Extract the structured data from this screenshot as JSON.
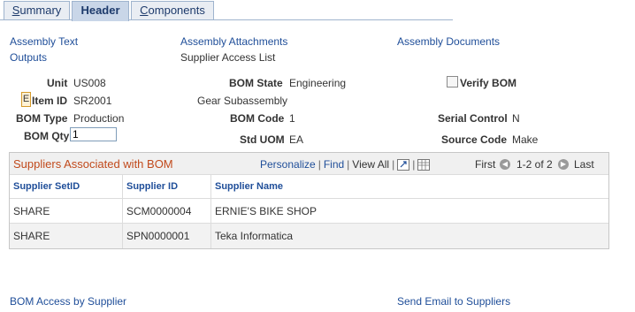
{
  "tabs": [
    {
      "label": "Summary",
      "accel": "S",
      "rest": "ummary"
    },
    {
      "label": "Header",
      "accel": "",
      "rest": "Header"
    },
    {
      "label": "Components",
      "accel": "C",
      "rest": "omponents"
    }
  ],
  "links": {
    "assembly_text": "Assembly Text",
    "assembly_attachments": "Assembly Attachments",
    "assembly_documents": "Assembly Documents",
    "outputs": "Outputs",
    "supplier_access_list": "Supplier Access List",
    "bom_access_by_supplier": "BOM Access by Supplier",
    "send_email": "Send Email to Suppliers"
  },
  "fields": {
    "unit_label": "Unit",
    "unit_value": "US008",
    "item_marker": "E",
    "item_id_label": "Item ID",
    "item_id_value": "SR2001",
    "item_desc": "Gear Subassembly",
    "bom_type_label": "BOM Type",
    "bom_type_value": "Production",
    "bom_qty_label": "BOM Qty",
    "bom_qty_value": "1",
    "bom_state_label": "BOM State",
    "bom_state_value": "Engineering",
    "bom_code_label": "BOM Code",
    "bom_code_value": "1",
    "std_uom_label": "Std UOM",
    "std_uom_value": "EA",
    "verify_bom_label": "Verify BOM",
    "serial_control_label": "Serial Control",
    "serial_control_value": "N",
    "source_code_label": "Source Code",
    "source_code_value": "Make"
  },
  "grid": {
    "title": "Suppliers Associated with BOM",
    "personalize": "Personalize",
    "find": "Find",
    "view_all": "View All",
    "first": "First",
    "range": "1-2 of 2",
    "last": "Last",
    "columns": [
      "Supplier SetID",
      "Supplier ID",
      "Supplier Name"
    ],
    "rows": [
      [
        "SHARE",
        "SCM0000004",
        "ERNIE'S BIKE SHOP"
      ],
      [
        "SHARE",
        "SPN0000001",
        "Teka Informatica"
      ]
    ]
  }
}
